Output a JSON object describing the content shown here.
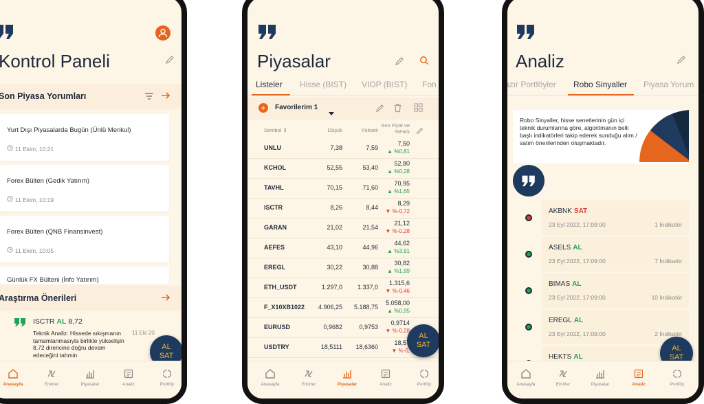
{
  "colors": {
    "accent": "#e6661e",
    "navy": "#1f3a5f",
    "up": "#22a35a",
    "down": "#e03b3b",
    "fab_text": "#f2b13b"
  },
  "nav": [
    {
      "label": "Anasayfa",
      "icon": "home-icon"
    },
    {
      "label": "Emirler",
      "icon": "orders-icon"
    },
    {
      "label": "Piyasalar",
      "icon": "markets-icon"
    },
    {
      "label": "Analiz",
      "icon": "analysis-icon"
    },
    {
      "label": "Portföy",
      "icon": "portfolio-icon"
    }
  ],
  "fab": {
    "line1": "AL",
    "line2": "SAT"
  },
  "dashboard": {
    "title": "Kontrol Paneli",
    "comments_title": "Son Piyasa Yorumları",
    "comments": [
      {
        "title": "Yurt Dışı Piyasalarda Bugün (Ünlü Menkul)",
        "time": "11 Ekim, 10:21"
      },
      {
        "title": "Forex Bülten (Gedik Yatırım)",
        "time": "11 Ekim, 10:19"
      },
      {
        "title": "Forex Bülten (QNB Finansinvest)",
        "time": "11 Ekim, 10:05"
      },
      {
        "title": "Günlük FX Bülteni (İnfo Yatırım)",
        "time": ""
      }
    ],
    "research_title": "Araştırma Önerileri",
    "research": {
      "symbol": "ISCTR",
      "action": "AL",
      "price": "8,72",
      "date": "11 Eki 20",
      "text": "Teknik Analiz: Hissede sıkışmanın tamamlanmasıyla birlikte yükselişin 8,72 direncine doğru devam edeceğini tahmin"
    }
  },
  "markets": {
    "title": "Piyasalar",
    "tabs": [
      "Listeler",
      "Hisse (BIST)",
      "VIOP (BIST)",
      "Fon"
    ],
    "list_name": "Favorilerim 1",
    "columns": {
      "symbol": "Sembol ⇕",
      "low": "Düşük",
      "high": "Yüksek",
      "last": "Son Fiyat ve %Fark"
    },
    "rows": [
      {
        "symbol": "UNLU",
        "low": "7,38",
        "high": "7,59",
        "last": "7,50",
        "change": "%0,81",
        "dir": "up"
      },
      {
        "symbol": "KCHOL",
        "low": "52,55",
        "high": "53,40",
        "last": "52,80",
        "change": "%0,28",
        "dir": "up"
      },
      {
        "symbol": "TAVHL",
        "low": "70,15",
        "high": "71,60",
        "last": "70,95",
        "change": "%1,65",
        "dir": "up"
      },
      {
        "symbol": "ISCTR",
        "low": "8,26",
        "high": "8,44",
        "last": "8,29",
        "change": "%-0,72",
        "dir": "down"
      },
      {
        "symbol": "GARAN",
        "low": "21,02",
        "high": "21,54",
        "last": "21,12",
        "change": "%-0,28",
        "dir": "down"
      },
      {
        "symbol": "AEFES",
        "low": "43,10",
        "high": "44,96",
        "last": "44,62",
        "change": "%3,91",
        "dir": "up"
      },
      {
        "symbol": "EREGL",
        "low": "30,22",
        "high": "30,88",
        "last": "30,82",
        "change": "%1,99",
        "dir": "up"
      },
      {
        "symbol": "ETH_USDT",
        "low": "1.297,0",
        "high": "1.337,0",
        "last": "1.315,6",
        "change": "%-0,46",
        "dir": "down"
      },
      {
        "symbol": "F_X10XB1022",
        "low": "4.906,25",
        "high": "5.188,75",
        "last": "5.058,00",
        "change": "%0,95",
        "dir": "up"
      },
      {
        "symbol": "EURUSD",
        "low": "0,9682",
        "high": "0,9753",
        "last": "0,9714",
        "change": "%-0,28",
        "dir": "down"
      },
      {
        "symbol": "USDTRY",
        "low": "18,5111",
        "high": "18,6360",
        "last": "18,57",
        "change": "%-0,",
        "dir": "down"
      }
    ]
  },
  "analysis": {
    "title": "Analiz",
    "tabs": [
      "azır Portföyler",
      "Robo Sinyaller",
      "Piyasa Yorum"
    ],
    "info_text": "Robo Sinyaller, hisse senetlerinin gün içi teknik durumlarına göre, algoritmanın belli başlı indikatörleri takip ederek sunduğu alım / satım önerilerinden oluşmaktadır.",
    "signals": [
      {
        "symbol": "AKBNK",
        "action": "SAT",
        "date": "23 Eyl 2022, 17:09:00",
        "indicators": "1 İndikatör",
        "dir": "down"
      },
      {
        "symbol": "ASELS",
        "action": "AL",
        "date": "23 Eyl 2022, 17:09:00",
        "indicators": "7 İndikatör",
        "dir": "up"
      },
      {
        "symbol": "BIMAS",
        "action": "AL",
        "date": "23 Eyl 2022, 17:09:00",
        "indicators": "10 İndikatör",
        "dir": "up"
      },
      {
        "symbol": "EREGL",
        "action": "AL",
        "date": "23 Eyl 2022, 17:09:00",
        "indicators": "2 İndikatör",
        "dir": "up"
      },
      {
        "symbol": "HEKTS",
        "action": "AL",
        "date": "",
        "indicators": "",
        "dir": "up"
      }
    ]
  }
}
